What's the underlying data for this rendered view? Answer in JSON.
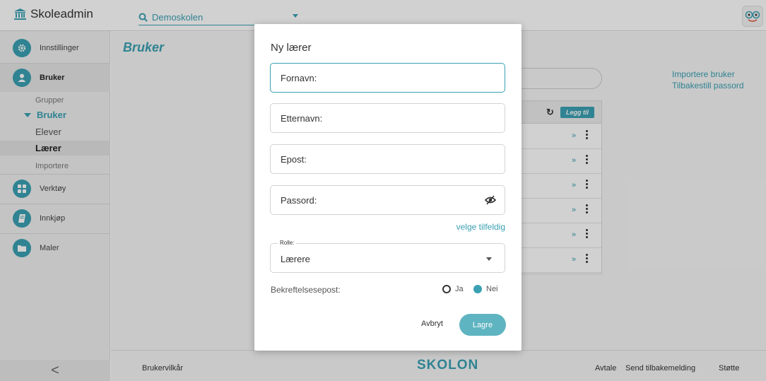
{
  "app": {
    "title": "Skoleadmin",
    "accent": "#3aa0b2"
  },
  "school_selector": {
    "value": "Demoskolen"
  },
  "sidebar": {
    "items": [
      {
        "label": "Innstillinger",
        "icon": "gear-icon"
      },
      {
        "label": "Bruker",
        "icon": "user-icon"
      },
      {
        "label": "Verktøy",
        "icon": "grid-icon"
      },
      {
        "label": "Innkjøp",
        "icon": "book-icon"
      },
      {
        "label": "Maler",
        "icon": "folder-icon"
      }
    ],
    "sub_items": {
      "grupper": "Grupper",
      "bruker": "Bruker",
      "elever": "Elever",
      "laerer": "Lærer",
      "importere": "Importere"
    },
    "collapse_label": "<"
  },
  "main": {
    "title": "Bruker",
    "links": {
      "import": "Importere bruker",
      "reset": "Tilbakestill passord"
    },
    "table": {
      "add_label": "Legg til",
      "row_count": 6
    }
  },
  "footer": {
    "terms": "Brukervilkår",
    "brand": "SKOLON",
    "agreement": "Avtale",
    "feedback": "Send tilbakemelding",
    "support": "Støtte"
  },
  "dialog": {
    "title": "Ny lærer",
    "fields": {
      "first_name": "Fornavn:",
      "last_name": "Etternavn:",
      "email": "Epost:",
      "password": "Passord:"
    },
    "random_link": "velge tilfeldig",
    "role": {
      "label": "Rolle:",
      "value": "Lærere"
    },
    "confirm": {
      "label": "Bekreftelsesepost:",
      "yes": "Ja",
      "no": "Nei",
      "selected": "Nei"
    },
    "cancel": "Avbryt",
    "save": "Lagre"
  }
}
